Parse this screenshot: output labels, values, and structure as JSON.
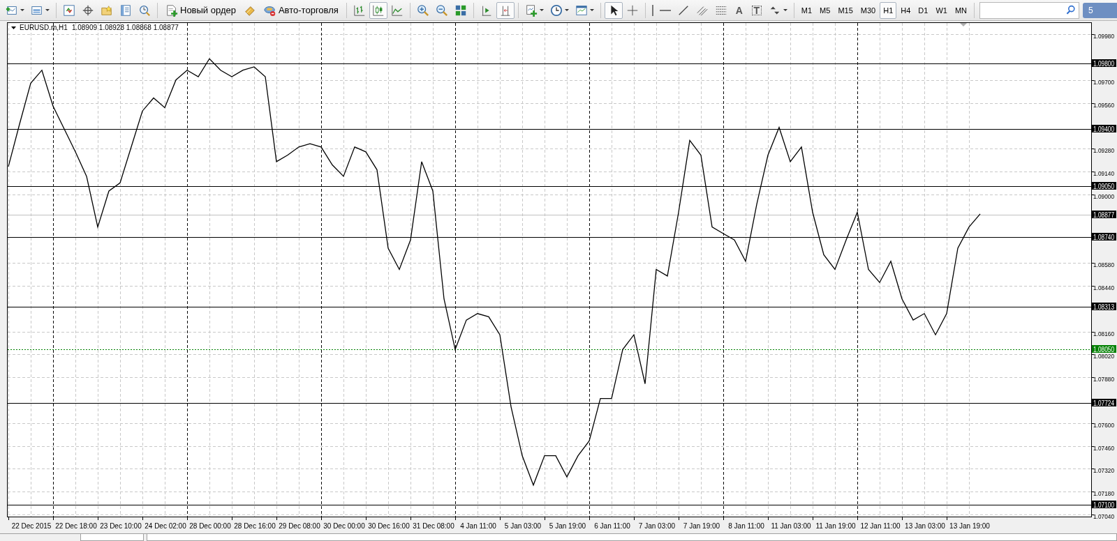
{
  "toolbar": {
    "new_order": "Новый ордер",
    "auto_trading": "Авто-торговля",
    "chart_type": [
      {
        "selected": false
      },
      {
        "selected": true
      },
      {
        "selected": false
      }
    ],
    "auto_scroll": {
      "on": false
    },
    "chart_shift": {
      "on": true
    },
    "cursor_mode": [
      {
        "selected": true
      },
      {
        "selected": false
      }
    ],
    "text_tool": "A",
    "label_tool": "T",
    "timeframes": [
      {
        "label": "M1",
        "selected": false
      },
      {
        "label": "M5",
        "selected": false
      },
      {
        "label": "M15",
        "selected": false
      },
      {
        "label": "M30",
        "selected": false
      },
      {
        "label": "H1",
        "selected": true
      },
      {
        "label": "H4",
        "selected": false
      },
      {
        "label": "D1",
        "selected": false
      },
      {
        "label": "W1",
        "selected": false
      },
      {
        "label": "MN",
        "selected": false
      }
    ],
    "notification_count": "5"
  },
  "chart": {
    "symbol": "EURUSD.m,H1",
    "ohlc": "1.08909 1.08928 1.08868 1.08877",
    "chart_data": {
      "type": "line",
      "grid": true,
      "categories": [
        null,
        null,
        "22 Dec 2015",
        null,
        null,
        null,
        "22 Dec 18:00",
        null,
        null,
        null,
        "23 Dec 10:00",
        null,
        null,
        null,
        "24 Dec 02:00",
        null,
        null,
        null,
        "28 Dec 00:00",
        null,
        null,
        null,
        "28 Dec 16:00",
        null,
        null,
        null,
        "29 Dec 08:00",
        null,
        null,
        null,
        "30 Dec 00:00",
        null,
        null,
        null,
        "30 Dec 16:00",
        null,
        null,
        null,
        "31 Dec 08:00",
        null,
        null,
        null,
        "4 Jan 11:00",
        null,
        null,
        null,
        "5 Jan 03:00",
        null,
        null,
        null,
        "5 Jan 19:00",
        null,
        null,
        null,
        "6 Jan 11:00",
        null,
        null,
        null,
        "7 Jan 03:00",
        null,
        null,
        null,
        "7 Jan 19:00",
        null,
        null,
        null,
        "8 Jan 11:00",
        null,
        null,
        null,
        "11 Jan 03:00",
        null,
        null,
        null,
        "11 Jan 19:00",
        null,
        null,
        null,
        "12 Jan 11:00",
        null,
        null,
        null,
        "13 Jan 03:00",
        null,
        null,
        null,
        "13 Jan 19:00",
        null
      ],
      "series": [
        {
          "color": "#000000",
          "values": [
            1.0917,
            1.0943,
            1.0968,
            1.0976,
            1.0954,
            1.094,
            1.0926,
            1.0911,
            1.088,
            1.0902,
            1.0907,
            1.0929,
            1.0951,
            1.0959,
            1.0953,
            1.097,
            1.0976,
            1.0972,
            1.0983,
            1.0976,
            1.0972,
            1.0976,
            1.0978,
            1.0972,
            1.092,
            1.0924,
            1.0929,
            1.0931,
            1.0929,
            1.0918,
            1.0911,
            1.0929,
            1.0926,
            1.0915,
            1.0867,
            1.0854,
            1.0872,
            1.092,
            1.0902,
            1.0836,
            1.0805,
            1.0823,
            1.0827,
            1.0825,
            1.0814,
            1.077,
            1.074,
            1.0722,
            1.074,
            1.074,
            1.0727,
            1.074,
            1.0749,
            1.0775,
            1.0775,
            1.0805,
            1.0814,
            1.0784,
            1.0854,
            1.085,
            1.0889,
            1.0933,
            1.0924,
            1.088,
            1.0876,
            1.0872,
            1.0859,
            1.0894,
            1.0924,
            1.0941,
            1.092,
            1.0929,
            1.0889,
            1.0863,
            1.0854,
            1.0872,
            1.0889,
            1.0854,
            1.0846,
            1.0859,
            1.0836,
            1.0823,
            1.0827,
            1.0814,
            1.0827,
            1.0867,
            1.088,
            1.0888
          ]
        }
      ],
      "ylim": [
        1.07027,
        1.10053
      ],
      "yticks": [
        {
          "value": 1.0998,
          "label": "1.09980"
        },
        {
          "value": 1.097,
          "label": "1.09700"
        },
        {
          "value": 1.0956,
          "label": "1.09560"
        },
        {
          "value": 1.0928,
          "label": "1.09280"
        },
        {
          "value": 1.0914,
          "label": "1.09140"
        },
        {
          "value": 1.09,
          "label": "1.09000"
        },
        {
          "value": 1.0858,
          "label": "1.08580"
        },
        {
          "value": 1.0844,
          "label": "1.08440"
        },
        {
          "value": 1.0816,
          "label": "1.08160"
        },
        {
          "value": 1.0802,
          "label": "1.08020"
        },
        {
          "value": 1.0788,
          "label": "1.07880"
        },
        {
          "value": 1.076,
          "label": "1.07600"
        },
        {
          "value": 1.0746,
          "label": "1.07460"
        },
        {
          "value": 1.0732,
          "label": "1.07320"
        },
        {
          "value": 1.0718,
          "label": "1.07180"
        },
        {
          "value": 1.0704,
          "label": "1.07040"
        }
      ],
      "ref_lines": [
        {
          "axis": "y",
          "value": 1.098,
          "label": "1.09800",
          "color": "#000000"
        },
        {
          "axis": "y",
          "value": 1.094,
          "label": "1.09400",
          "color": "#000000"
        },
        {
          "axis": "y",
          "value": 1.0905,
          "label": "1.09050",
          "color": "#000000"
        },
        {
          "axis": "y",
          "value": 1.08877,
          "label": "1.08877",
          "color": "#c0c0c0"
        },
        {
          "axis": "y",
          "value": 1.0874,
          "label": "1.08740",
          "color": "#000000"
        },
        {
          "axis": "y",
          "value": 1.08313,
          "label": "1.08313",
          "color": "#000000"
        },
        {
          "axis": "y",
          "value": 1.0805,
          "label": "1.08050",
          "color": "#008000"
        },
        {
          "axis": "y",
          "value": 1.07724,
          "label": "1.07724",
          "color": "#000000"
        },
        {
          "axis": "y",
          "value": 1.071,
          "label": "1.07100",
          "color": "#000000"
        }
      ]
    }
  }
}
